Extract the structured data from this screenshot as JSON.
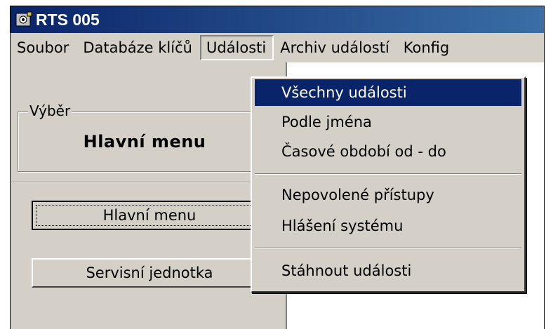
{
  "window": {
    "title": "RTS 005"
  },
  "menubar": {
    "items": [
      "Soubor",
      "Databáze klíčů",
      "Události",
      "Archiv událostí",
      "Konfig"
    ]
  },
  "dropdown": {
    "items": [
      "Všechny události",
      "Podle jména",
      "Časové období od - do",
      "Nepovolené přístupy",
      "Hlášení systému",
      "Stáhnout události"
    ],
    "selected": "Všechny události"
  },
  "left_panel": {
    "group_label": "Výběr",
    "group_value": "Hlavní menu",
    "buttons": {
      "main_menu": "Hlavní menu",
      "service_unit": "Servisní jednotka"
    }
  }
}
